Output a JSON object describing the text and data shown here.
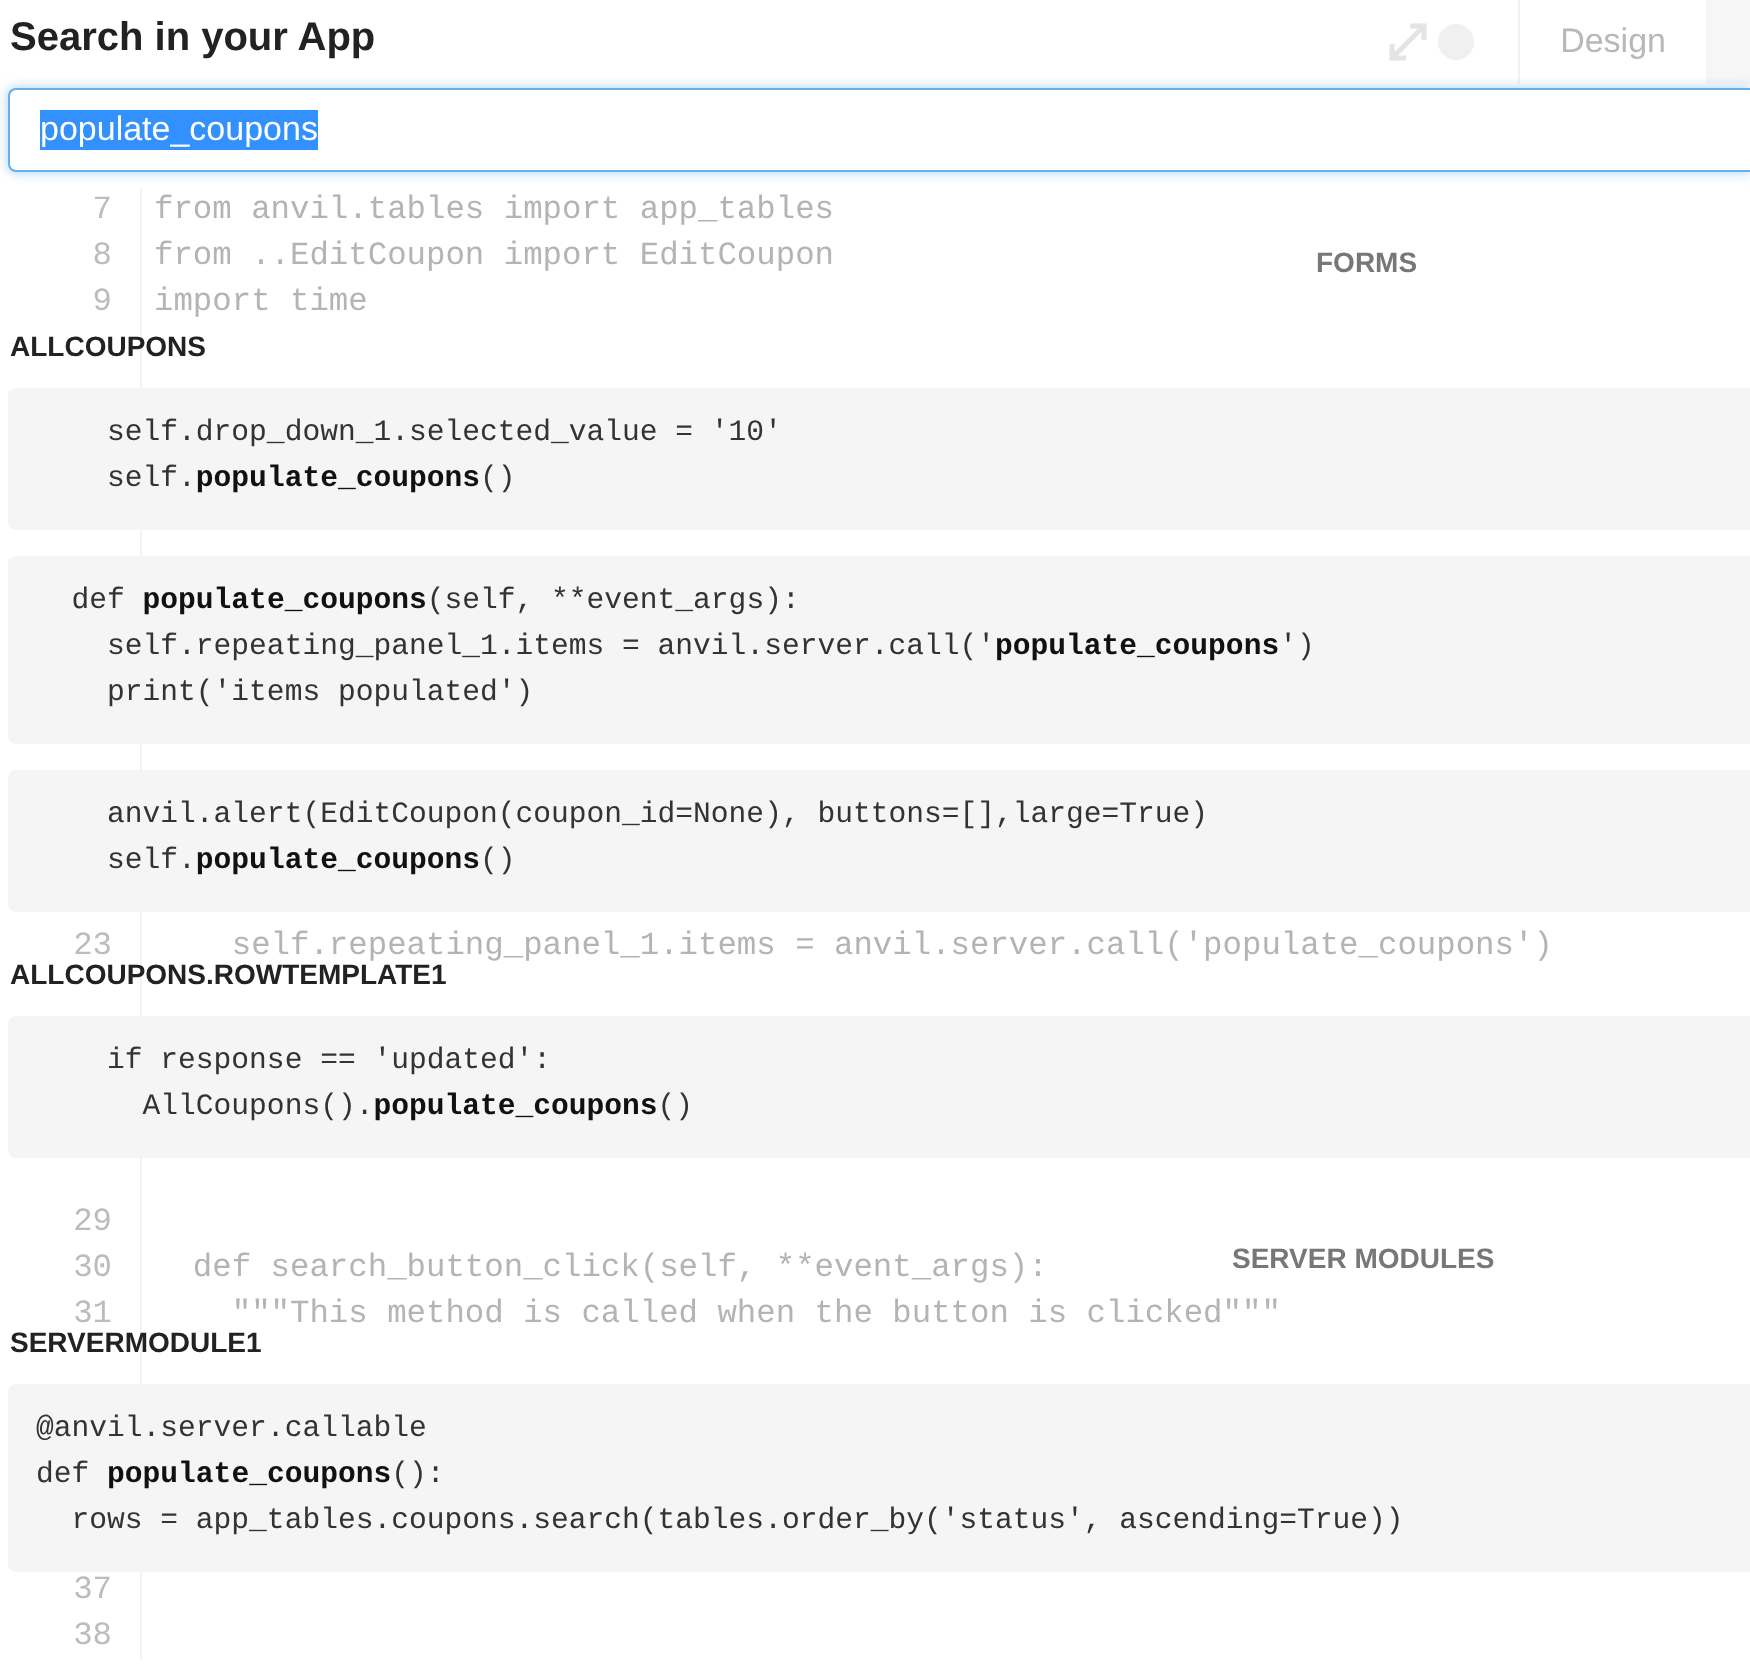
{
  "editor": {
    "tab": "Design",
    "lines": [
      {
        "number": "7",
        "code": "from anvil.tables import app_tables"
      },
      {
        "number": "8",
        "code": "from ..EditCoupon import EditCoupon"
      },
      {
        "number": "9",
        "code": "import time"
      },
      {
        "number": "23",
        "code": "    self.repeating_panel_1.items = anvil.server.call('populate_coupons')"
      },
      {
        "number": "29"
      },
      {
        "number": "30",
        "code": "  def search_button_click(self, **event_args):"
      },
      {
        "number": "31",
        "code": "    \"\"\"This method is called when the button is clicked\"\"\""
      },
      {
        "number": "37"
      },
      {
        "number": "38"
      }
    ]
  },
  "title": "Search in your App",
  "search": {
    "value": "populate_coupons",
    "selected": true
  },
  "groups": [
    {
      "category": "FORMS",
      "modules": [
        {
          "name": "ALLCOUPONS",
          "snippets": [
            [
              "    self.drop_down_1.selected_value = '10'",
              "    self.**populate_coupons**()"
            ],
            [
              "  def **populate_coupons**(self, **event_args):",
              "    self.repeating_panel_1.items = anvil.server.call('**populate_coupons**')",
              "    print('items populated')"
            ],
            [
              "    anvil.alert(EditCoupon(coupon_id=None), buttons=[],large=True)",
              "    self.**populate_coupons**()"
            ]
          ]
        },
        {
          "name": "ALLCOUPONS.ROWTEMPLATE1",
          "snippets": [
            [
              "    if response == 'updated':",
              "      AllCoupons().**populate_coupons**()"
            ]
          ]
        }
      ]
    },
    {
      "category": "SERVER MODULES",
      "modules": [
        {
          "name": "SERVERMODULE1",
          "snippets": [
            [
              "@anvil.server.callable",
              "def **populate_coupons**():",
              "  rows = app_tables.coupons.search(tables.order_by('status', ascending=True))"
            ]
          ]
        }
      ]
    }
  ]
}
